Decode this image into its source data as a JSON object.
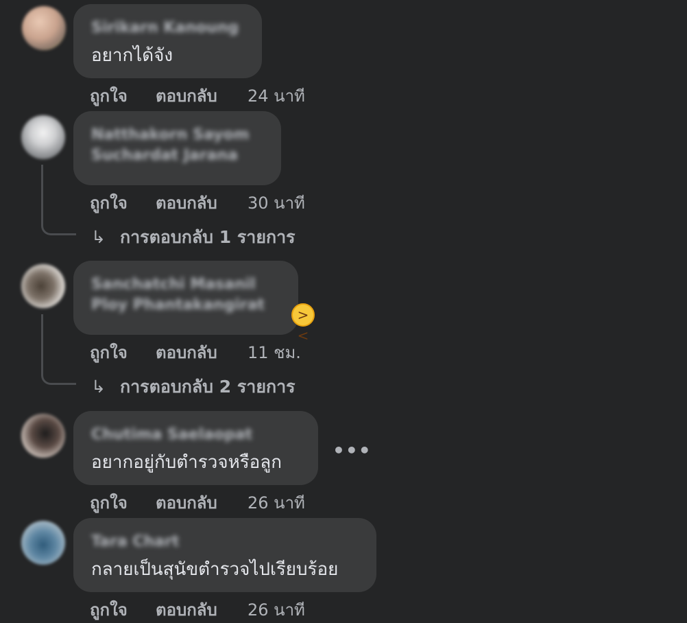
{
  "actions": {
    "like": "ถูกใจ",
    "reply": "ตอบกลับ"
  },
  "comments": [
    {
      "name": "Sirikarn Kanoung",
      "name_line2": "",
      "text": "อยากได้จัง",
      "time": "24 นาที",
      "replies": ""
    },
    {
      "name": "Natthakorn Sayom",
      "name_line2": "Suchardat Jarana",
      "text": "",
      "time": "30 นาที",
      "replies": "การตอบกลับ 1 รายการ"
    },
    {
      "name": "Sanchatchi Masanil",
      "name_line2": "Ploy Phantakangirat",
      "text": "",
      "time": "11 ชม.",
      "replies": "การตอบกลับ 2 รายการ",
      "emoji": "grinning-squinting-face"
    },
    {
      "name": "Chutima Saelaopat",
      "name_line2": "",
      "text": "อยากอยู่กับตำรวจหรือลูก",
      "time": "26 นาที",
      "replies": ""
    },
    {
      "name": "Tara Chart",
      "name_line2": "",
      "text": "กลายเป็นสุนัขตำรวจไปเรียบร้อย",
      "time": "26 นาที",
      "replies": ""
    }
  ],
  "icons": {
    "reply_arrow": "↳",
    "more": "•••",
    "emoji_face": "😆"
  },
  "colors": {
    "background": "#242526",
    "bubble": "#3a3b3c",
    "primary_text": "#e4e6eb",
    "secondary_text": "#b0b3b8"
  }
}
